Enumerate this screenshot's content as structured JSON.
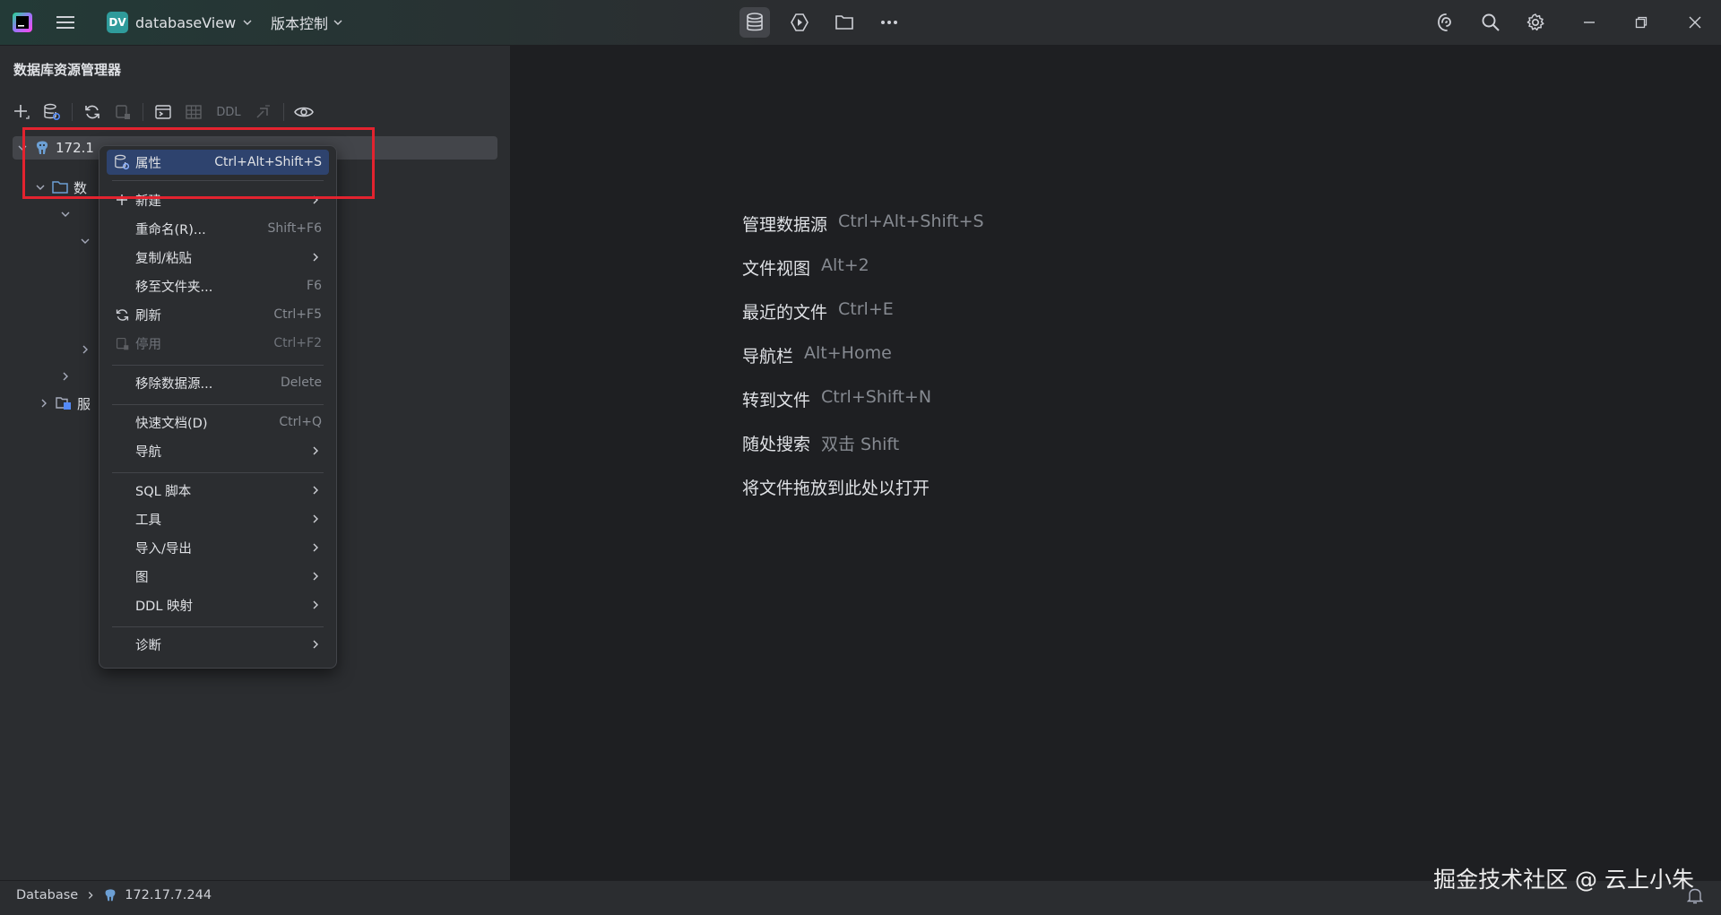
{
  "titlebar": {
    "project_badge": "DV",
    "project_name": "databaseView",
    "vcs_label": "版本控制"
  },
  "left_panel": {
    "title": "数据库资源管理器",
    "toolbar": {
      "ddl_label": "DDL"
    },
    "tree": {
      "root_label": "172.1",
      "databases_label": "数",
      "server_objects_label": "服"
    }
  },
  "context_menu": {
    "items": [
      {
        "label": "属性",
        "shortcut": "Ctrl+Alt+Shift+S",
        "icon": "datasource-properties-icon"
      },
      {
        "label": "新建",
        "shortcut": "",
        "icon": "plus-icon"
      },
      {
        "label": "重命名(R)...",
        "shortcut": "Shift+F6"
      },
      {
        "label": "复制/粘贴",
        "shortcut": ""
      },
      {
        "label": "移至文件夹...",
        "shortcut": "F6"
      },
      {
        "label": "刷新",
        "shortcut": "Ctrl+F5",
        "icon": "refresh-icon"
      },
      {
        "label": "停用",
        "shortcut": "Ctrl+F2",
        "icon": "deactivate-icon"
      },
      {
        "label": "移除数据源...",
        "shortcut": "Delete"
      },
      {
        "label": "快速文档(D)",
        "shortcut": "Ctrl+Q"
      },
      {
        "label": "导航",
        "shortcut": ""
      },
      {
        "label": "SQL 脚本",
        "shortcut": ""
      },
      {
        "label": "工具",
        "shortcut": ""
      },
      {
        "label": "导入/导出",
        "shortcut": ""
      },
      {
        "label": "图",
        "shortcut": ""
      },
      {
        "label": "DDL 映射",
        "shortcut": ""
      },
      {
        "label": "诊断",
        "shortcut": ""
      }
    ]
  },
  "editor_hints": [
    {
      "action": "管理数据源",
      "shortcut": "Ctrl+Alt+Shift+S"
    },
    {
      "action": "文件视图",
      "shortcut": "Alt+2"
    },
    {
      "action": "最近的文件",
      "shortcut": "Ctrl+E"
    },
    {
      "action": "导航栏",
      "shortcut": "Alt+Home"
    },
    {
      "action": "转到文件",
      "shortcut": "Ctrl+Shift+N"
    },
    {
      "action": "随处搜索",
      "shortcut": "双击 Shift"
    },
    {
      "action": "将文件拖放到此处以打开",
      "shortcut": ""
    }
  ],
  "statusbar": {
    "breadcrumb_root": "Database",
    "breadcrumb_host": "172.17.7.244"
  },
  "watermark": "掘金技术社区 @ 云上小朱",
  "colors": {
    "background": "#2b2d30",
    "editor_background": "#1e1f22",
    "selection": "#2e436e",
    "annotation_red": "#e3232f",
    "project_badge": "#2f9b9b"
  }
}
